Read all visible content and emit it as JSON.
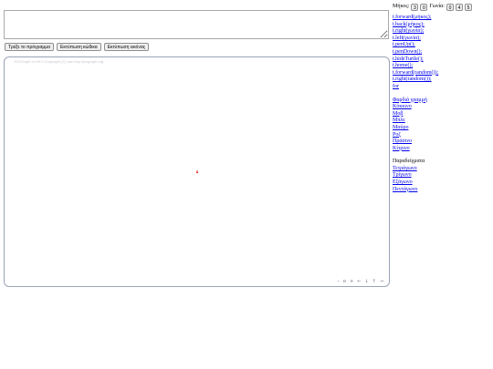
{
  "toolbar": {
    "run_label": "Τρέξε το πρόγραμμα",
    "export_code_label": "Εκτύπωση κώδικα",
    "export_image_label": "Εκτύπωση εικόνας"
  },
  "canvas": {
    "copyright": "JSXGraph v0.99.4 Copyright (C) see http://jsxgraph.org",
    "nav": [
      "–",
      "o",
      "+",
      "←",
      "↓",
      "↑",
      "→"
    ]
  },
  "params": {
    "length_label": "Μήκος:",
    "length_values": [
      "3",
      "0"
    ],
    "angle_label": "Γωνία:",
    "angle_values": [
      "0",
      "4",
      "5"
    ]
  },
  "commands": [
    "t.forward(μήκος);",
    "t.back(μήκος);",
    "t.right(γωνία);",
    "t.left(γωνία);",
    "t.penUp();",
    "t.penDown();",
    "t.hideTurtle();",
    "t.home();",
    "t.forward(random());",
    "t.right(random());",
    "for"
  ],
  "colors": [
    "Φαρδιά γραμμή",
    "Κόκκινο",
    "Μοβ",
    "Μπλε",
    "Μαύρο",
    "Ροζ",
    "Πράσινο",
    "Κίτρινο"
  ],
  "examples": {
    "title": "Παραδείγματα",
    "items": [
      "Τετράγωνο",
      "Τρίγωνο",
      "Εξάγωνο",
      "Πεντάγωνο"
    ]
  }
}
